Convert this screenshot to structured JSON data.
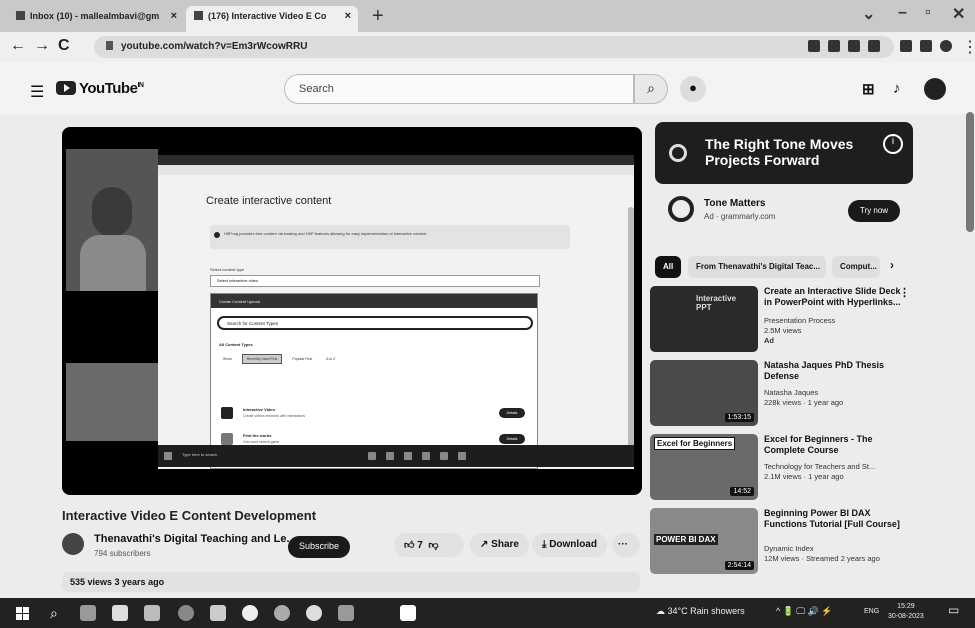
{
  "browser": {
    "tabs": [
      {
        "label": "Inbox (10) - mallealmbavi@gm",
        "active": false
      },
      {
        "label": "(176) Interactive Video E Co",
        "active": true
      }
    ],
    "new_tab": "+",
    "address": "youtube.com/watch?v=Em3rWcowRRU",
    "nav": {
      "back": "←",
      "forward": "→",
      "reload": "C"
    }
  },
  "youtube": {
    "logo": "YouTube",
    "logo_sup": "IN",
    "search_placeholder": "Search"
  },
  "video": {
    "title": "Interactive Video E Content Development",
    "channel": "Thenavathi's Digital Teaching and Le...",
    "subscribers": "794 subscribers",
    "subscribe_label": "Subscribe",
    "likes": "7",
    "share_label": "Share",
    "download_label": "Download",
    "more": "···",
    "views_line": "535 views  3 years ago",
    "frame": {
      "heading": "Create interactive content",
      "info_text": "H5P.org provides free content via hosting and H5P features allowing for easy implementation of interactive content",
      "select_label": "Select content type",
      "select_value": "Select interactive video",
      "modal_bar": "Create Content   Upload",
      "modal_search": "Search for Content Types",
      "types_heading": "All Content Types",
      "filter_tabs": [
        "Show",
        "Recently Used First",
        "Popular First",
        "A to Z"
      ],
      "items": [
        {
          "name": "Interactive Video",
          "desc": "Create videos enriched with interactions",
          "button": "Details"
        },
        {
          "name": "Find the words",
          "desc": "Grid word search game",
          "button": "Details"
        }
      ],
      "taskbar_search": "Type here to search"
    }
  },
  "sidebar": {
    "ad": {
      "title": "The Right Tone Moves Projects Forward",
      "info": "i",
      "advertiser": "Tone Matters",
      "domain": "Ad · grammarly.com",
      "cta": "Try now"
    },
    "chips": [
      "All",
      "From Thenavathi's Digital Teac...",
      "Comput..."
    ],
    "chip_next": "›",
    "recommendations": [
      {
        "title": "Create an Interactive Slide Deck in PowerPoint with Hyperlinks...",
        "channel": "Presentation Process",
        "stats": "2.5M views",
        "badge": "Ad",
        "duration": "",
        "thumb_text": "Interactive PPT"
      },
      {
        "title": "Natasha Jaques PhD Thesis Defense",
        "channel": "Natasha Jaques",
        "stats": "228k views · 1 year ago",
        "badge": "",
        "duration": "1:53:15",
        "thumb_text": ""
      },
      {
        "title": "Excel for Beginners - The Complete Course",
        "channel": "Technology for Teachers and St...",
        "stats": "2.1M views · 1 year ago",
        "badge": "",
        "duration": "14:52",
        "thumb_text": "Excel for Beginners"
      },
      {
        "title": "Beginning Power BI DAX Functions Tutorial [Full Course]",
        "channel": "Dynamic Index",
        "stats": "12M views · Streamed 2 years ago",
        "badge": "",
        "duration": "2:54:14",
        "thumb_text": "POWER BI DAX"
      }
    ]
  },
  "taskbar": {
    "weather": "34°C  Rain showers",
    "tray_icons": "^ 🔋 🖵 🔊 ⚡",
    "lang": "ENG",
    "time": "15:29",
    "date": "30-08-2023"
  }
}
